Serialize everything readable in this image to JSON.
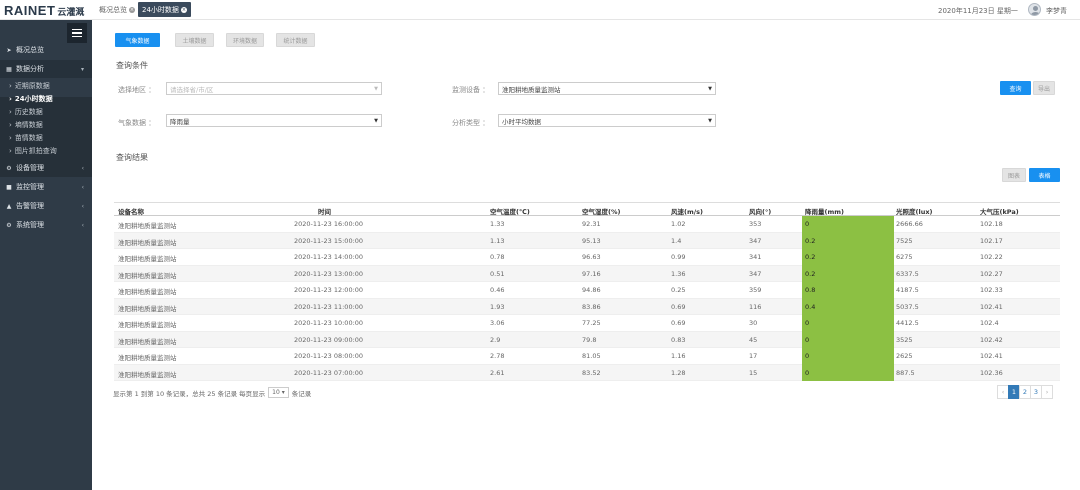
{
  "header": {
    "logo_en": "RAINET",
    "logo_cn": "云灌溉",
    "tabs": [
      {
        "label": "概况总览"
      },
      {
        "label": "24小时数据"
      }
    ],
    "date": "2020年11月23日 星期一",
    "user": "李梦青"
  },
  "sidebar": {
    "items": [
      {
        "label": "概况总览"
      },
      {
        "label": "数据分析"
      },
      {
        "label": "设备管理"
      },
      {
        "label": "监控管理"
      },
      {
        "label": "告警管理"
      },
      {
        "label": "系统管理"
      }
    ],
    "subitems": [
      {
        "label": "近期原数据"
      },
      {
        "label": "24小时数据"
      },
      {
        "label": "历史数据"
      },
      {
        "label": "墒情数据"
      },
      {
        "label": "苗情数据"
      },
      {
        "label": "图片抓拍查询"
      }
    ]
  },
  "main": {
    "tabs": [
      "气象数据",
      "土壤数据",
      "环境数据",
      "统计数据"
    ],
    "query_title": "查询条件",
    "region_label": "选择地区 ：",
    "region_placeholder": "请选择省/市/区",
    "device_label": "监测设备 ：",
    "device_value": "淮阳耕地质量监测站",
    "meteo_label": "气象数据 ：",
    "meteo_value": "降雨量",
    "analysis_label": "分析类型 ：",
    "analysis_value": "小时平均数据",
    "query_button": "查询",
    "export_button": "导出",
    "result_title": "查询结果",
    "chart_button": "图表",
    "table_button": "表格"
  },
  "table": {
    "columns": [
      "设备名称",
      "时间",
      "空气温度(℃)",
      "空气湿度(%)",
      "风速(m/s)",
      "风向(°)",
      "降雨量(mm)",
      "光照度(lux)",
      "大气压(kPa)"
    ],
    "rows": [
      [
        "淮阳耕地质量监测站",
        "2020-11-23 16:00:00",
        "1.33",
        "92.31",
        "1.02",
        "353",
        "0",
        "2666.66",
        "102.18"
      ],
      [
        "淮阳耕地质量监测站",
        "2020-11-23 15:00:00",
        "1.13",
        "95.13",
        "1.4",
        "347",
        "0.2",
        "7525",
        "102.17"
      ],
      [
        "淮阳耕地质量监测站",
        "2020-11-23 14:00:00",
        "0.78",
        "96.63",
        "0.99",
        "341",
        "0.2",
        "6275",
        "102.22"
      ],
      [
        "淮阳耕地质量监测站",
        "2020-11-23 13:00:00",
        "0.51",
        "97.16",
        "1.36",
        "347",
        "0.2",
        "6337.5",
        "102.27"
      ],
      [
        "淮阳耕地质量监测站",
        "2020-11-23 12:00:00",
        "0.46",
        "94.86",
        "0.25",
        "359",
        "0.8",
        "4187.5",
        "102.33"
      ],
      [
        "淮阳耕地质量监测站",
        "2020-11-23 11:00:00",
        "1.93",
        "83.86",
        "0.69",
        "116",
        "0.4",
        "5037.5",
        "102.41"
      ],
      [
        "淮阳耕地质量监测站",
        "2020-11-23 10:00:00",
        "3.06",
        "77.25",
        "0.69",
        "30",
        "0",
        "4412.5",
        "102.4"
      ],
      [
        "淮阳耕地质量监测站",
        "2020-11-23 09:00:00",
        "2.9",
        "79.8",
        "0.83",
        "45",
        "0",
        "3525",
        "102.42"
      ],
      [
        "淮阳耕地质量监测站",
        "2020-11-23 08:00:00",
        "2.78",
        "81.05",
        "1.16",
        "17",
        "0",
        "2625",
        "102.41"
      ],
      [
        "淮阳耕地质量监测站",
        "2020-11-23 07:00:00",
        "2.61",
        "83.52",
        "1.28",
        "15",
        "0",
        "887.5",
        "102.36"
      ]
    ]
  },
  "footer": {
    "info_prefix": "显示第 1 到第 10 条记录，总共 25 条记录 每页显示",
    "page_size": "10",
    "info_suffix": "条记录",
    "pages": [
      "‹",
      "1",
      "2",
      "3",
      "›"
    ]
  },
  "colors": {
    "primary": "#1890f0",
    "sidebar": "#2f3b47",
    "rain_highlight": "#8cc043"
  }
}
